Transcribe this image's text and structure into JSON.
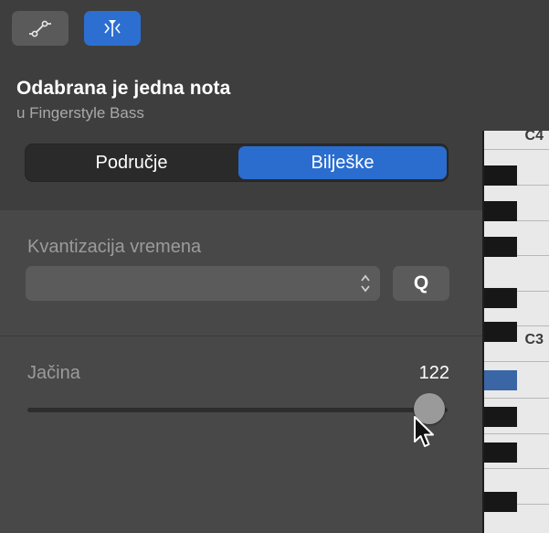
{
  "toolbar": {
    "buttons": [
      {
        "icon": "automation-curve-icon",
        "active": false
      },
      {
        "icon": "midi-filter-icon",
        "active": true
      }
    ]
  },
  "header": {
    "title": "Odabrana je jedna nota",
    "subtitle": "u Fingerstyle Bass"
  },
  "segmented": {
    "items": [
      {
        "label": "Područje",
        "selected": false
      },
      {
        "label": "Bilješke",
        "selected": true
      }
    ]
  },
  "quantize": {
    "label": "Kvantizacija vremena",
    "value": "",
    "q_label": "Q"
  },
  "velocity": {
    "label": "Jačina",
    "value": "122",
    "fraction": 0.96
  },
  "piano": {
    "octave_labels": [
      "C4",
      "C3"
    ]
  },
  "colors": {
    "accent": "#2a6dcf",
    "panel": "#484848",
    "header": "#3e3e3e"
  }
}
